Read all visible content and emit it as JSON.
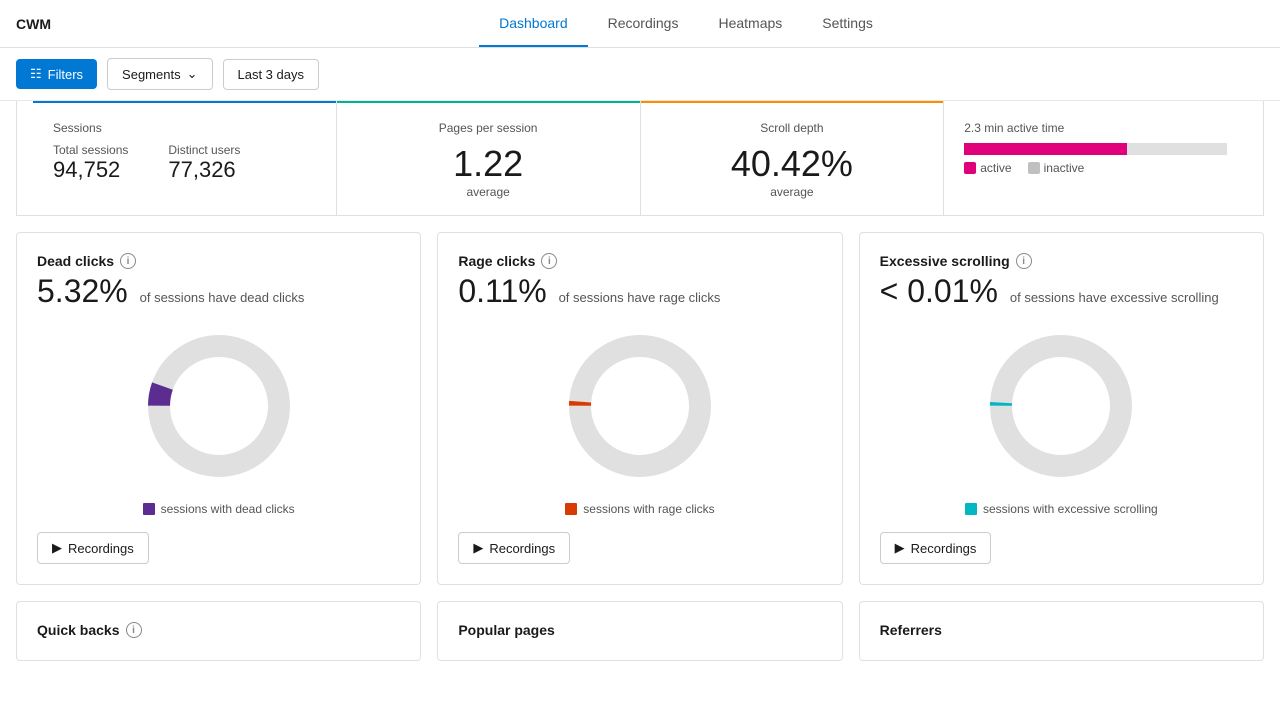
{
  "app": {
    "title": "CWM"
  },
  "nav": {
    "links": [
      {
        "id": "dashboard",
        "label": "Dashboard",
        "active": true
      },
      {
        "id": "recordings",
        "label": "Recordings",
        "active": false
      },
      {
        "id": "heatmaps",
        "label": "Heatmaps",
        "active": false
      },
      {
        "id": "settings",
        "label": "Settings",
        "active": false
      }
    ]
  },
  "toolbar": {
    "filters_label": "Filters",
    "segments_label": "Segments",
    "date_range_label": "Last 3 days"
  },
  "stats": {
    "sessions_label": "Sessions",
    "total_sessions_label": "Total sessions",
    "total_sessions_value": "94,752",
    "distinct_users_label": "Distinct users",
    "distinct_users_value": "77,326",
    "pages_per_session_label": "Pages per session",
    "pages_per_session_value": "1.22",
    "pages_per_session_avg": "average",
    "scroll_depth_label": "Scroll depth",
    "scroll_depth_value": "40.42%",
    "scroll_depth_avg": "average",
    "active_time_label": "2.3 min active time",
    "active_label": "active",
    "inactive_label": "inactive"
  },
  "dead_clicks": {
    "title": "Dead clicks",
    "percent": "5.32%",
    "description": "of sessions have dead clicks",
    "legend_label": "sessions with dead clicks",
    "recordings_label": "Recordings",
    "donut_color": "#5c2d91",
    "donut_percent": 5.32
  },
  "rage_clicks": {
    "title": "Rage clicks",
    "percent": "0.11%",
    "description": "of sessions have rage clicks",
    "legend_label": "sessions with rage clicks",
    "recordings_label": "Recordings",
    "donut_color": "#d83b01",
    "donut_percent": 0.11
  },
  "excessive_scrolling": {
    "title": "Excessive scrolling",
    "percent": "< 0.01%",
    "description": "of sessions have excessive scrolling",
    "legend_label": "sessions with excessive scrolling",
    "recordings_label": "Recordings",
    "donut_color": "#00b7c3",
    "donut_percent": 0.01
  },
  "bottom": {
    "quick_backs_label": "Quick backs",
    "popular_pages_label": "Popular pages",
    "referrers_label": "Referrers"
  }
}
